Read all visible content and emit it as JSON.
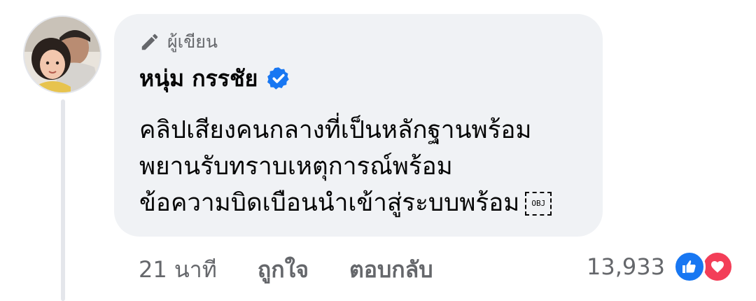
{
  "comment": {
    "author_badge": "ผู้เขียน",
    "author_name": "หนุ่ม กรรชัย",
    "verified": true,
    "text_lines": [
      "คลิปเสียงคนกลางที่เป็นหลักฐานพร้อม",
      "พยานรับทราบเหตุการณ์พร้อม",
      "ข้อความบิดเบือนนำเข้าสู่ระบบพร้อม"
    ],
    "object_placeholder": "OBJ"
  },
  "actions": {
    "time": "21 นาที",
    "like_label": "ถูกใจ",
    "reply_label": "ตอบกลับ"
  },
  "reactions": {
    "count": "13,933",
    "types": [
      "like-icon",
      "love-icon"
    ]
  },
  "colors": {
    "bubble_bg": "#f0f2f5",
    "secondary_text": "#65676b",
    "verified_blue": "#1877f2",
    "like_blue": "#1877f2",
    "love_red": "#f33e58"
  }
}
